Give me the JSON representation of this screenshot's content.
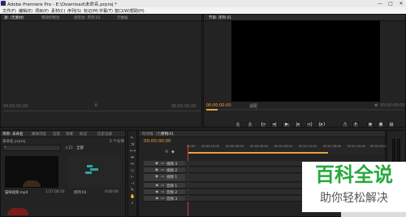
{
  "titlebar": {
    "title": "Adobe Premiere Pro - E:\\Download\\未命名.prproj *",
    "min": "—",
    "max": "□",
    "close": "✕"
  },
  "menus": [
    "文件(F)",
    "编辑(E)",
    "项目(P)",
    "素材(C)",
    "序列(S)",
    "标记(M)",
    "字幕(T)",
    "窗口(W)",
    "帮助(H)"
  ],
  "source": {
    "tabs": [
      "源: (无素材)",
      "特效控制台",
      "调音台: 序列 01",
      "元数据"
    ],
    "timecode_left": "00;00;00;00",
    "timecode_right": "00;00;00;00"
  },
  "program": {
    "tab": "节目: 序列 01",
    "timecode_left": "00:00:00:00",
    "fit": "适配",
    "timecode_right": "00:00:00:00"
  },
  "project": {
    "tabs": [
      "项目: 未命名",
      "媒体浏览",
      "信息",
      "效果",
      "标记",
      "历史记录"
    ],
    "filename": "未命名.prproj",
    "count": "2 个分项",
    "entry_label": "入口:",
    "entry_value": "全部",
    "items": [
      {
        "name": "猫咪视频.mp4",
        "duration": "1:57:00:10"
      },
      {
        "name": "序列 01",
        "duration": "0:00:00"
      }
    ]
  },
  "timeline": {
    "tabs": [
      "时间线: (无序列)",
      "序列 01"
    ],
    "timecode": "00:00:00:00",
    "ruler": [
      "00:00",
      "00:00:15:00",
      "00:00:30:00",
      "00:00:45:00",
      "00:01:00:00",
      "00:01:15:00",
      "00:01:30:00",
      "00:01:45:00",
      "00:02:00:00"
    ],
    "tracks": [
      {
        "name": "视频 3",
        "kind": "video"
      },
      {
        "name": "视频 2",
        "kind": "video"
      },
      {
        "name": "视频 1",
        "kind": "video"
      },
      {
        "name": "音频 1",
        "kind": "audio"
      },
      {
        "name": "音频 2",
        "kind": "audio"
      },
      {
        "name": "音频 3",
        "kind": "audio"
      }
    ]
  },
  "watermark": {
    "line1": "百科全说",
    "line2": "助你轻松解决"
  },
  "colors": {
    "accent": "#e8a23a",
    "watermark_green": "#27a93c"
  }
}
